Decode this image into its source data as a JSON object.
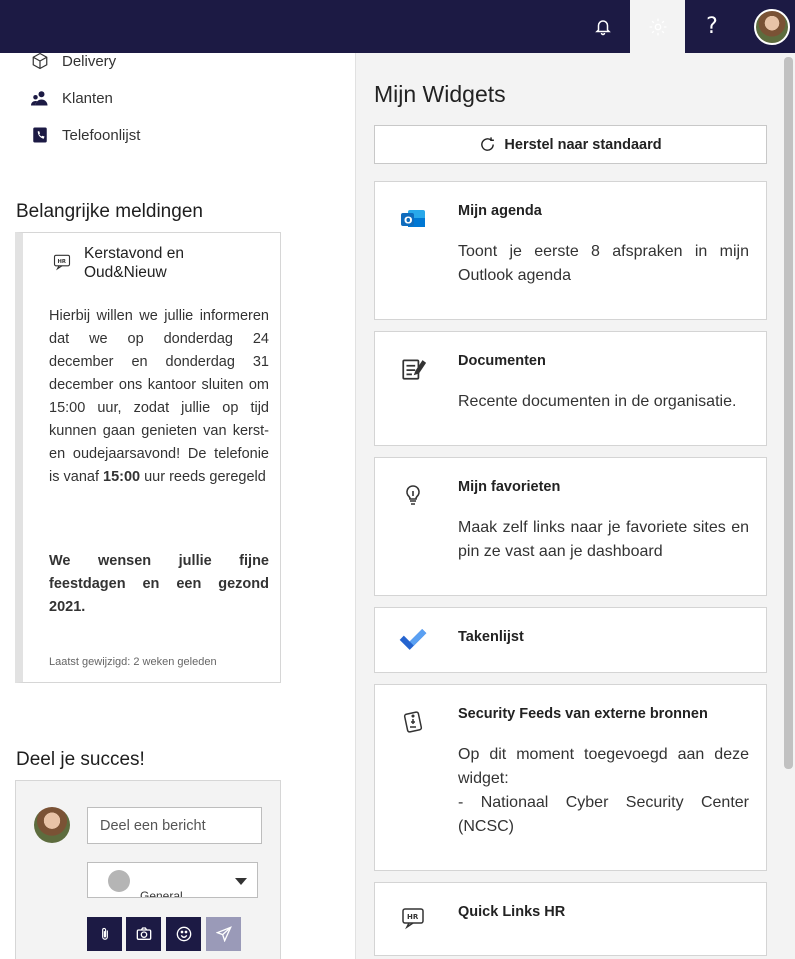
{
  "topbar": {
    "bell_icon": "bell-icon",
    "settings_icon": "gear-icon",
    "help_label": "?",
    "avatar_icon": "user-avatar"
  },
  "nav": {
    "items": [
      {
        "label": "Delivery",
        "icon": "box-icon"
      },
      {
        "label": "Klanten",
        "icon": "users-icon"
      },
      {
        "label": "Telefoonlijst",
        "icon": "phonebook-icon"
      }
    ]
  },
  "notices": {
    "title": "Belangrijke meldingen",
    "card": {
      "icon": "hr-chat-icon",
      "title": "Kerstavond en Oud&Nieuw",
      "body_pre": "Hierbij willen we jullie informeren dat we op donderdag 24 december en donderdag 31 december ons kantoor sluiten om 15:00 uur, zodat jullie op tijd kunnen gaan genieten van kerst- en oudejaarsavond! De telefonie is vanaf ",
      "body_bold": "15:00",
      "body_post": " uur reeds geregeld",
      "wish": "We wensen jullie fijne feestdagen en een gezond 2021.",
      "footer": "Laatst gewijzigd: 2 weken geleden"
    }
  },
  "share": {
    "title": "Deel je succes!",
    "placeholder": "Deel een bericht",
    "channel": "General",
    "buttons": [
      "paperclip-icon",
      "camera-icon",
      "smiley-icon",
      "send-icon"
    ]
  },
  "widgets_panel": {
    "title": "Mijn Widgets",
    "reset_label": "Herstel naar standaard",
    "widgets": [
      {
        "title": "Mijn agenda",
        "desc": "Toont je eerste 8 afspraken in mijn Outlook agenda",
        "icon": "outlook-icon"
      },
      {
        "title": "Documenten",
        "desc": "Recente documenten in de organisatie.",
        "icon": "document-edit-icon"
      },
      {
        "title": "Mijn favorieten",
        "desc": "Maak zelf links naar je favoriete sites en pin ze vast aan je dashboard",
        "icon": "lightbulb-icon"
      },
      {
        "title": "Takenlijst",
        "desc": "",
        "icon": "todo-check-icon"
      },
      {
        "title": "Security Feeds van externe bronnen",
        "desc": "Op dit moment toegevoegd aan deze widget:",
        "desc2": "- Nationaal Cyber Security Center (NCSC)",
        "icon": "security-feed-icon"
      },
      {
        "title": "Quick Links HR",
        "desc": "",
        "icon": "hr-chat-icon"
      }
    ]
  },
  "colors": {
    "topbar": "#1c1a44",
    "panel_bg": "#f3f3f3",
    "accent_blue": "#0f6cbd"
  }
}
